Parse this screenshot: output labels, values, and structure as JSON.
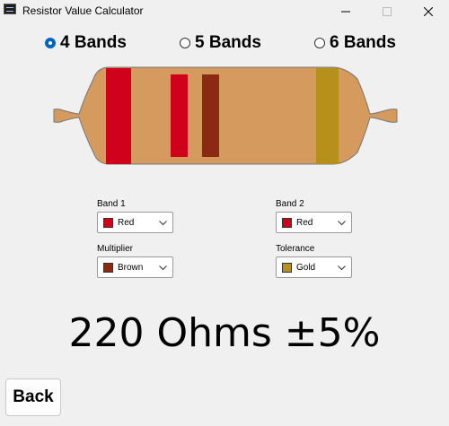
{
  "window": {
    "title": "Resistor Value Calculator"
  },
  "band_mode": {
    "options": [
      {
        "label": "4 Bands",
        "selected": true
      },
      {
        "label": "5 Bands",
        "selected": false
      },
      {
        "label": "6 Bands",
        "selected": false
      }
    ]
  },
  "resistor": {
    "body_color": "#d49a5e",
    "band_colors": [
      "#d0021b",
      "#d0021b",
      "#8b2a13",
      "#b5911c"
    ]
  },
  "selectors": {
    "band1": {
      "label": "Band 1",
      "value": "Red",
      "swatch": "#d0021b"
    },
    "band2": {
      "label": "Band 2",
      "value": "Red",
      "swatch": "#d0021b"
    },
    "multiplier": {
      "label": "Multiplier",
      "value": "Brown",
      "swatch": "#8b2a13"
    },
    "tolerance": {
      "label": "Tolerance",
      "value": "Gold",
      "swatch": "#b5911c"
    }
  },
  "result": {
    "text": "220 Ohms ±5%"
  },
  "back_button": {
    "label": "Back"
  }
}
